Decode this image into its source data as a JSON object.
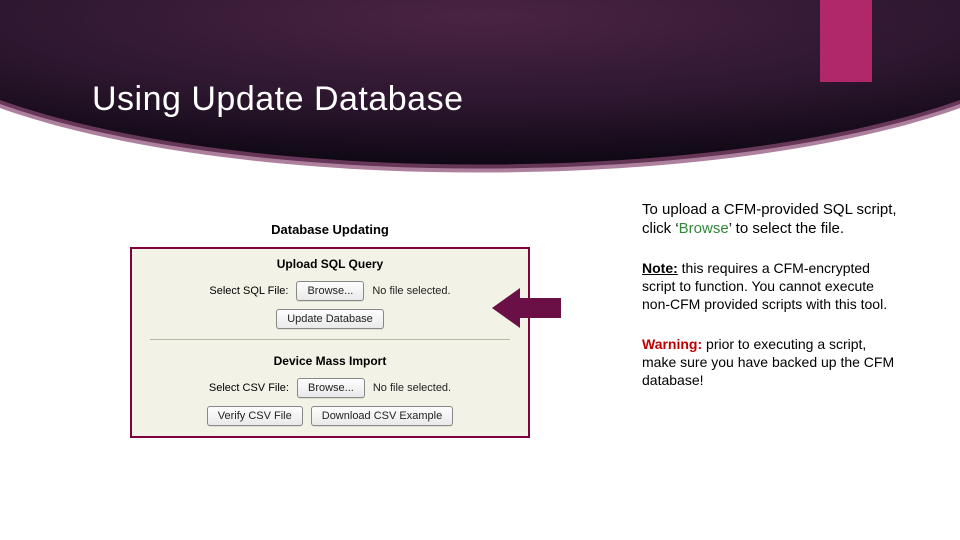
{
  "header": {
    "title": "Using Update Database"
  },
  "panel": {
    "title": "Database Updating",
    "upload_section_header": "Upload SQL Query",
    "upload": {
      "label": "Select SQL File:",
      "browse_label": "Browse...",
      "status": "No file selected.",
      "update_label": "Update Database"
    },
    "mass_import_section_header": "Device Mass Import",
    "mass_import": {
      "label": "Select CSV File:",
      "browse_label": "Browse...",
      "status": "No file selected.",
      "verify_label": "Verify CSV File",
      "download_label": "Download CSV Example"
    }
  },
  "instructions": {
    "p1_prefix": "To upload a CFM-provided SQL script, click ‘",
    "browse_word": "Browse",
    "p1_suffix": "’ to select the file.",
    "note_label": "Note:",
    "note_body": " this requires a CFM-encrypted script to function. You cannot execute non-CFM provided scripts with this tool.",
    "warning_label": "Warning:",
    "warning_body": " prior to executing a script, make sure you have backed up the CFM database!"
  }
}
